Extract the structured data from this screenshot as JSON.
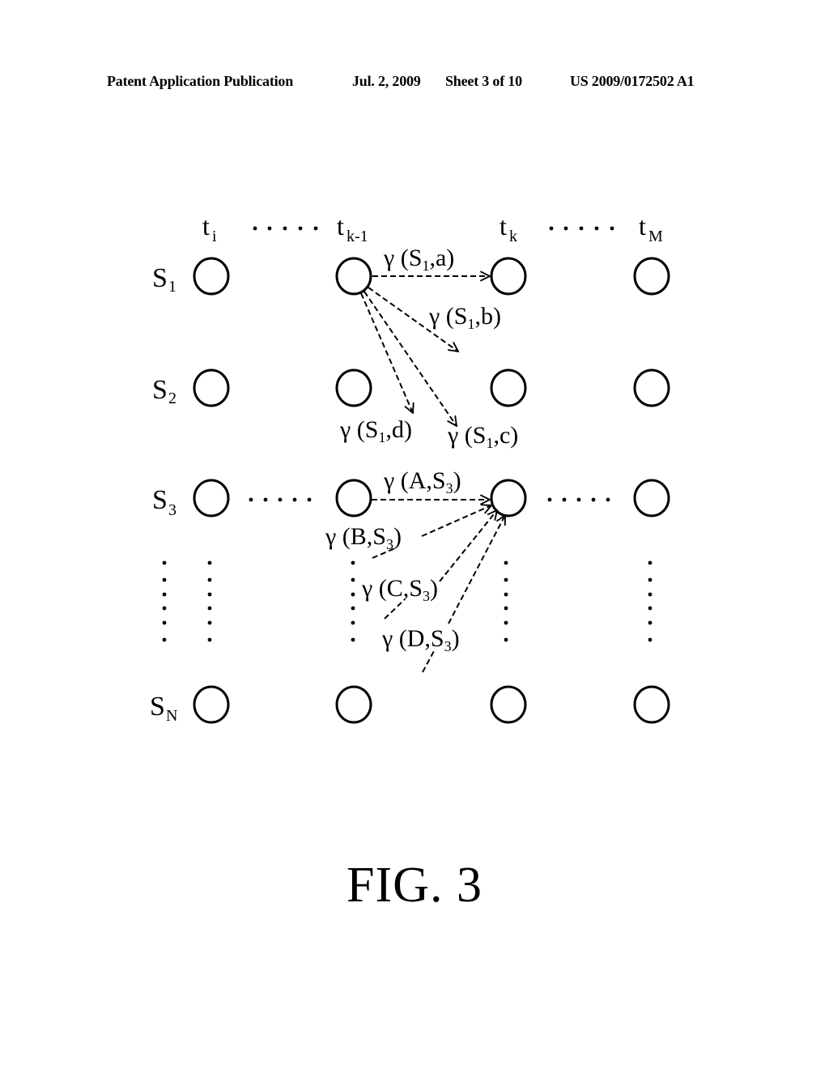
{
  "header": {
    "left": "Patent Application Publication",
    "date": "Jul. 2, 2009",
    "sheet": "Sheet 3 of 10",
    "pub_number": "US 2009/0172502 A1"
  },
  "figure_label": "FIG. 3",
  "time_columns": [
    {
      "base": "t",
      "sub": "i"
    },
    {
      "base": "t",
      "sub": "k-1"
    },
    {
      "base": "t",
      "sub": "k"
    },
    {
      "base": "t",
      "sub": "M"
    }
  ],
  "state_rows": [
    {
      "base": "S",
      "sub": "1"
    },
    {
      "base": "S",
      "sub": "2"
    },
    {
      "base": "S",
      "sub": "3"
    },
    {
      "base": "S",
      "sub": "N"
    }
  ],
  "edges_from_s1": [
    {
      "label_pre": "γ (S",
      "label_sub": "1",
      "label_post": ",a)",
      "target": "a"
    },
    {
      "label_pre": "γ (S",
      "label_sub": "1",
      "label_post": ",b)",
      "target": "b"
    },
    {
      "label_pre": "γ (S",
      "label_sub": "1",
      "label_post": ",c)",
      "target": "c"
    },
    {
      "label_pre": "γ (S",
      "label_sub": "1",
      "label_post": ",d)",
      "target": "d"
    }
  ],
  "edges_to_s3": [
    {
      "label_pre": "γ (A,S",
      "label_sub": "3",
      "label_post": ")",
      "source": "A"
    },
    {
      "label_pre": "γ (B,S",
      "label_sub": "3",
      "label_post": ")",
      "source": "B"
    },
    {
      "label_pre": "γ (C,S",
      "label_sub": "3",
      "label_post": ")",
      "source": "C"
    },
    {
      "label_pre": "γ (D,S",
      "label_sub": "3",
      "label_post": ")",
      "source": "D"
    }
  ]
}
